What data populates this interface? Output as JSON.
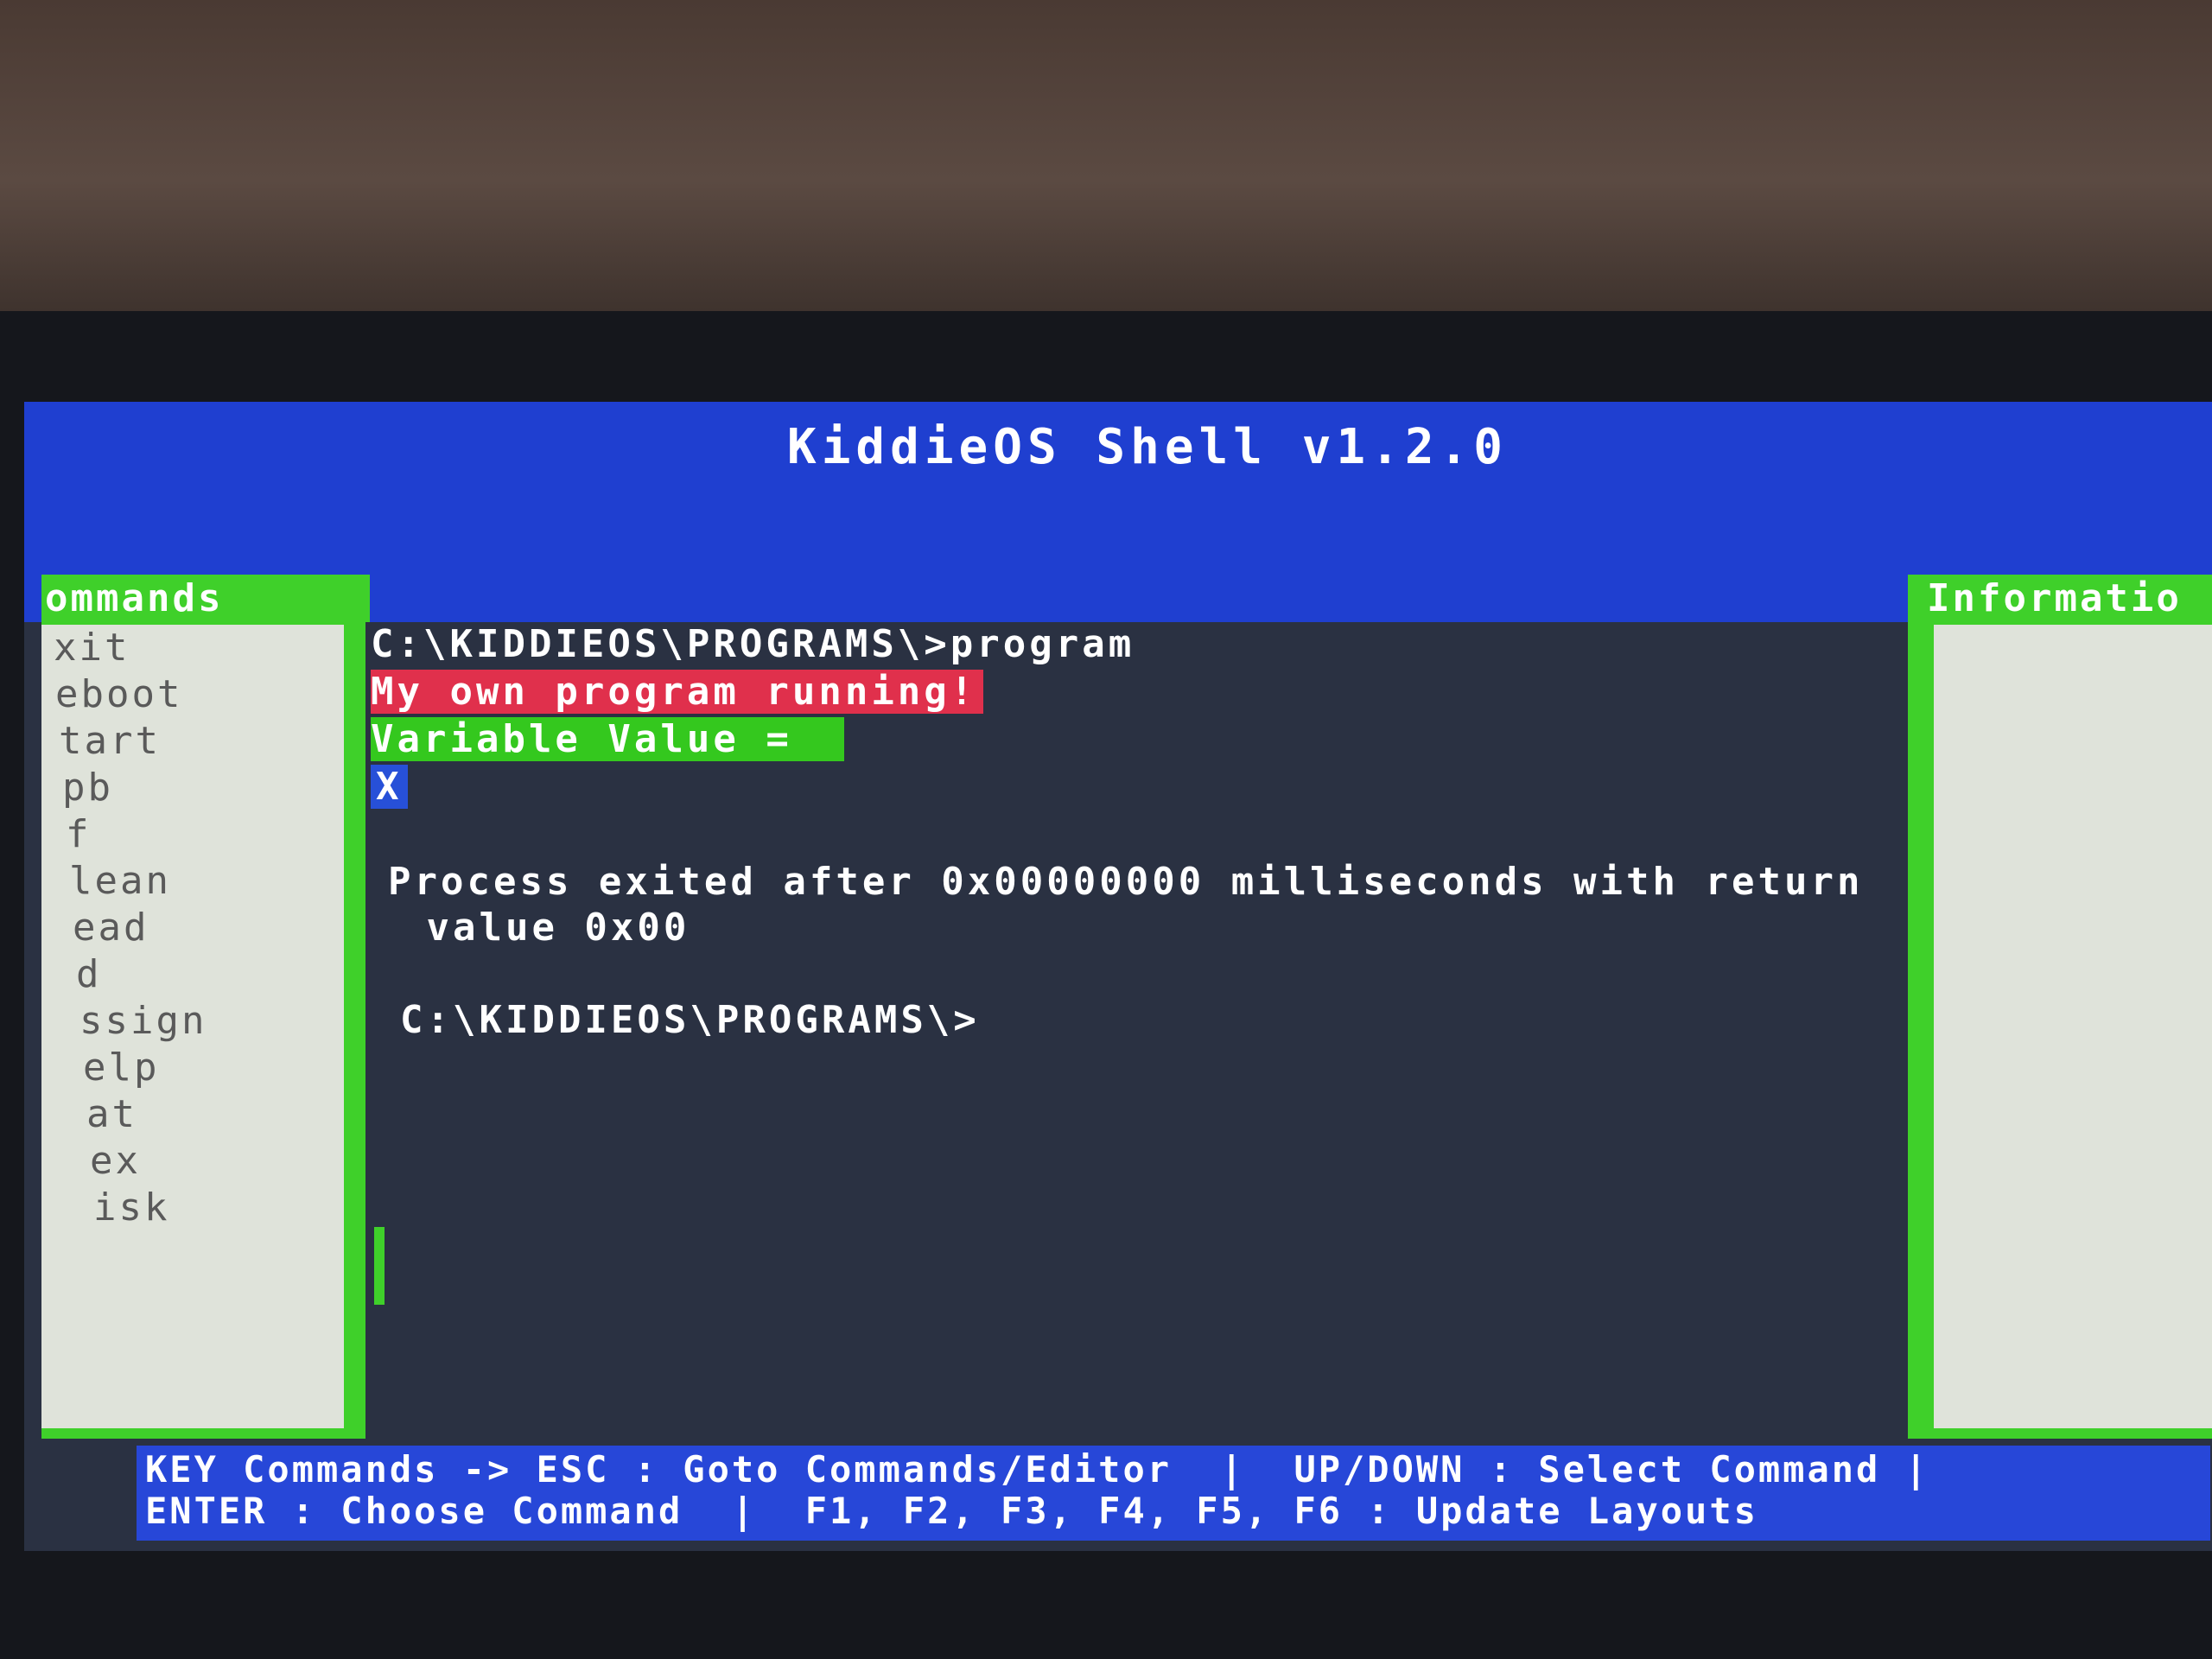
{
  "header": {
    "title": "KiddieOS Shell v1.2.0"
  },
  "commands_panel": {
    "title": "ommands",
    "items": [
      "xit",
      "eboot",
      "tart",
      "pb",
      "f",
      "lean",
      "ead",
      "d",
      "ssign",
      "elp",
      "at",
      "ex",
      "isk"
    ]
  },
  "info_panel": {
    "title": "Informatio"
  },
  "console": {
    "prompt_command": "C:\\KIDDIEOS\\PROGRAMS\\>program",
    "program_message": "My own program running!",
    "variable_label": "Variable Value =",
    "variable_value": "X",
    "exit_line_1": "Process exited after 0x00000000 milliseconds with return",
    "exit_line_2": " value 0x00",
    "prompt": "C:\\KIDDIEOS\\PROGRAMS\\>"
  },
  "footer": {
    "line_1": "KEY Commands -> ESC : Goto Commands/Editor  |  UP/DOWN : Select Command |",
    "line_2": "ENTER : Choose Command  |  F1, F2, F3, F4, F5, F6 : Update Layouts"
  },
  "colors": {
    "header_blue": "#1f3fd0",
    "panel_green": "#3fd02a",
    "console_bg": "#2a3142",
    "highlight_red": "#e0304c"
  }
}
